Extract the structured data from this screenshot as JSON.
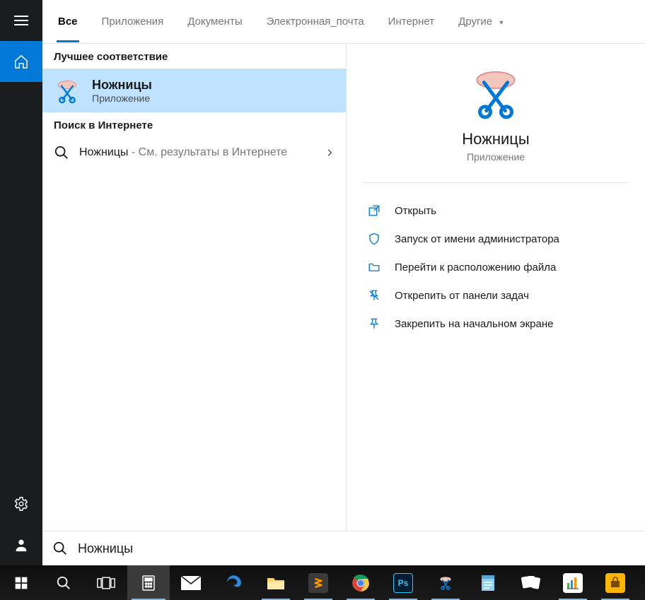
{
  "tabs": {
    "all": "Все",
    "apps": "Приложения",
    "documents": "Документы",
    "email": "Электронная_почта",
    "internet": "Интернет",
    "more": "Другие"
  },
  "sections": {
    "best_match": "Лучшее соответствие",
    "web_search": "Поиск в Интернете"
  },
  "best_match": {
    "title": "Ножницы",
    "subtitle": "Приложение"
  },
  "web_result": {
    "query": "Ножницы",
    "suffix": " - См. результаты в Интернете"
  },
  "preview": {
    "title": "Ножницы",
    "subtitle": "Приложение",
    "actions": {
      "open": "Открыть",
      "run_admin": "Запуск от имени администратора",
      "open_location": "Перейти к расположению файла",
      "unpin_taskbar": "Открепить от панели задач",
      "pin_start": "Закрепить на начальном экране"
    }
  },
  "search": {
    "value": "Ножницы"
  },
  "taskbar": {
    "start": "start",
    "search": "search",
    "taskview": "task-view",
    "apps": [
      "calculator",
      "mail",
      "edge",
      "explorer",
      "sublime",
      "chrome",
      "photoshop",
      "snipping-tool",
      "notepad",
      "solitaire",
      "chart-app",
      "store-app"
    ]
  }
}
